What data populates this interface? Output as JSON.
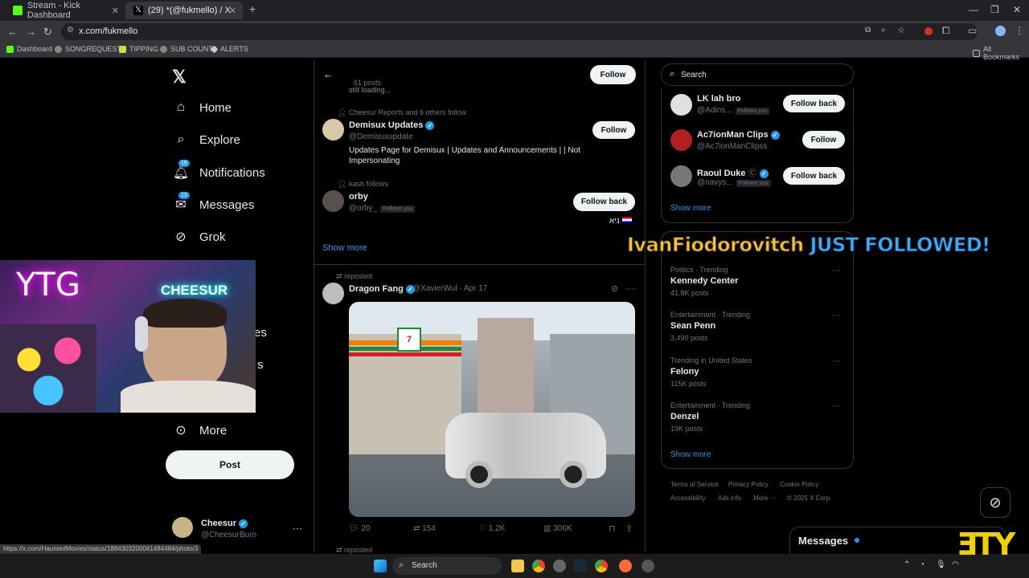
{
  "browser": {
    "tabs": [
      {
        "label": "Stream - Kick Dashboard",
        "favicon_color": "#53fc18"
      },
      {
        "label": "(29) *(@fukmello) / X",
        "favicon_color": "#ffffff"
      }
    ],
    "url": "x.com/fukmello",
    "bookmarks": [
      "Dashboard",
      "SONGREQUESTS",
      "TIPPING",
      "SUB COUNT",
      "ALERTS"
    ],
    "all_bookmarks": "All Bookmarks"
  },
  "leftnav": {
    "items": [
      {
        "label": "Home",
        "icon": "home-icon"
      },
      {
        "label": "Explore",
        "icon": "search-icon"
      },
      {
        "label": "Notifications",
        "icon": "bell-icon",
        "badge": "16"
      },
      {
        "label": "Messages",
        "icon": "mail-icon",
        "badge": "13"
      },
      {
        "label": "Grok",
        "icon": "grok-icon"
      },
      {
        "label": "More",
        "icon": "more-circle-icon"
      }
    ],
    "partial_labels": [
      "es",
      "s"
    ],
    "post_label": "Post",
    "account": {
      "name": "Cheesur",
      "handle": "@CheesurBurn"
    }
  },
  "center": {
    "header_posts": "61 posts",
    "header_loading": "still loading...",
    "follow_label": "Follow",
    "suggestions": [
      {
        "context": "Cheesur Reports and 6 others follow",
        "name": "Demisux Updates",
        "handle": "@Demisuxupdate",
        "verified": true,
        "bio": "Updates Page for Demisux | Updates and Announcements | | Not Impersonating",
        "button": "Follow"
      },
      {
        "context": "kash follows",
        "name": "orby",
        "handle": "@orby_",
        "follows_you": "Follows you",
        "bio": "ניא",
        "button": "Follow back"
      }
    ],
    "show_more": "Show more",
    "repost": {
      "reposted_label": "reposted",
      "author": "Dragon Fang",
      "handle": "@XavierWul",
      "date": "· Apr 17",
      "stats": {
        "replies": "20",
        "reposts": "154",
        "likes": "1.2K",
        "views": "306K"
      }
    },
    "next_reposted": "reposted"
  },
  "right": {
    "search_placeholder": "Search",
    "who_to_follow": [
      {
        "name": "LK lah bro",
        "handle": "@Adins...",
        "follows_you": "Follows you",
        "button": "Follow back"
      },
      {
        "name": "Ac7ionMan Clips",
        "handle": "@Ac7ionManClipss",
        "verified": true,
        "button": "Follow"
      },
      {
        "name": "Raoul Duke",
        "handle": "@navys...",
        "verified": true,
        "follows_you": "Follows you",
        "button": "Follow back"
      }
    ],
    "show_more": "Show more",
    "trends": [
      {
        "category": "Politics · Trending",
        "name": "Kennedy Center",
        "count": "41.8K posts"
      },
      {
        "category": "Entertainment · Trending",
        "name": "Sean Penn",
        "count": "3,490 posts"
      },
      {
        "category": "Trending in United States",
        "name": "Felony",
        "count": "115K posts"
      },
      {
        "category": "Entertainment · Trending",
        "name": "Denzel",
        "count": "19K posts"
      }
    ],
    "trends_show_more": "Show more",
    "footer": [
      "Terms of Service",
      "Privacy Policy",
      "Cookie Policy",
      "Accessibility",
      "Ads info",
      "More ···",
      "© 2025 X Corp."
    ],
    "messages_drawer": "Messages"
  },
  "overlay": {
    "follower_name": "IvanFiodorovitch",
    "followed_text": "JUST FOLLOWED!",
    "cam_sign_left": "YTG",
    "cam_sign_right": "CHEESUR"
  },
  "status_url": "https://x.com/HauntedMovies/status/1884303200041484484/photo/3",
  "taskbar": {
    "search": "Search"
  },
  "colors": {
    "accent": "#1d9bf0",
    "follow_overlay_name": "#f6c431",
    "follow_overlay_text": "#3fa9f5"
  }
}
